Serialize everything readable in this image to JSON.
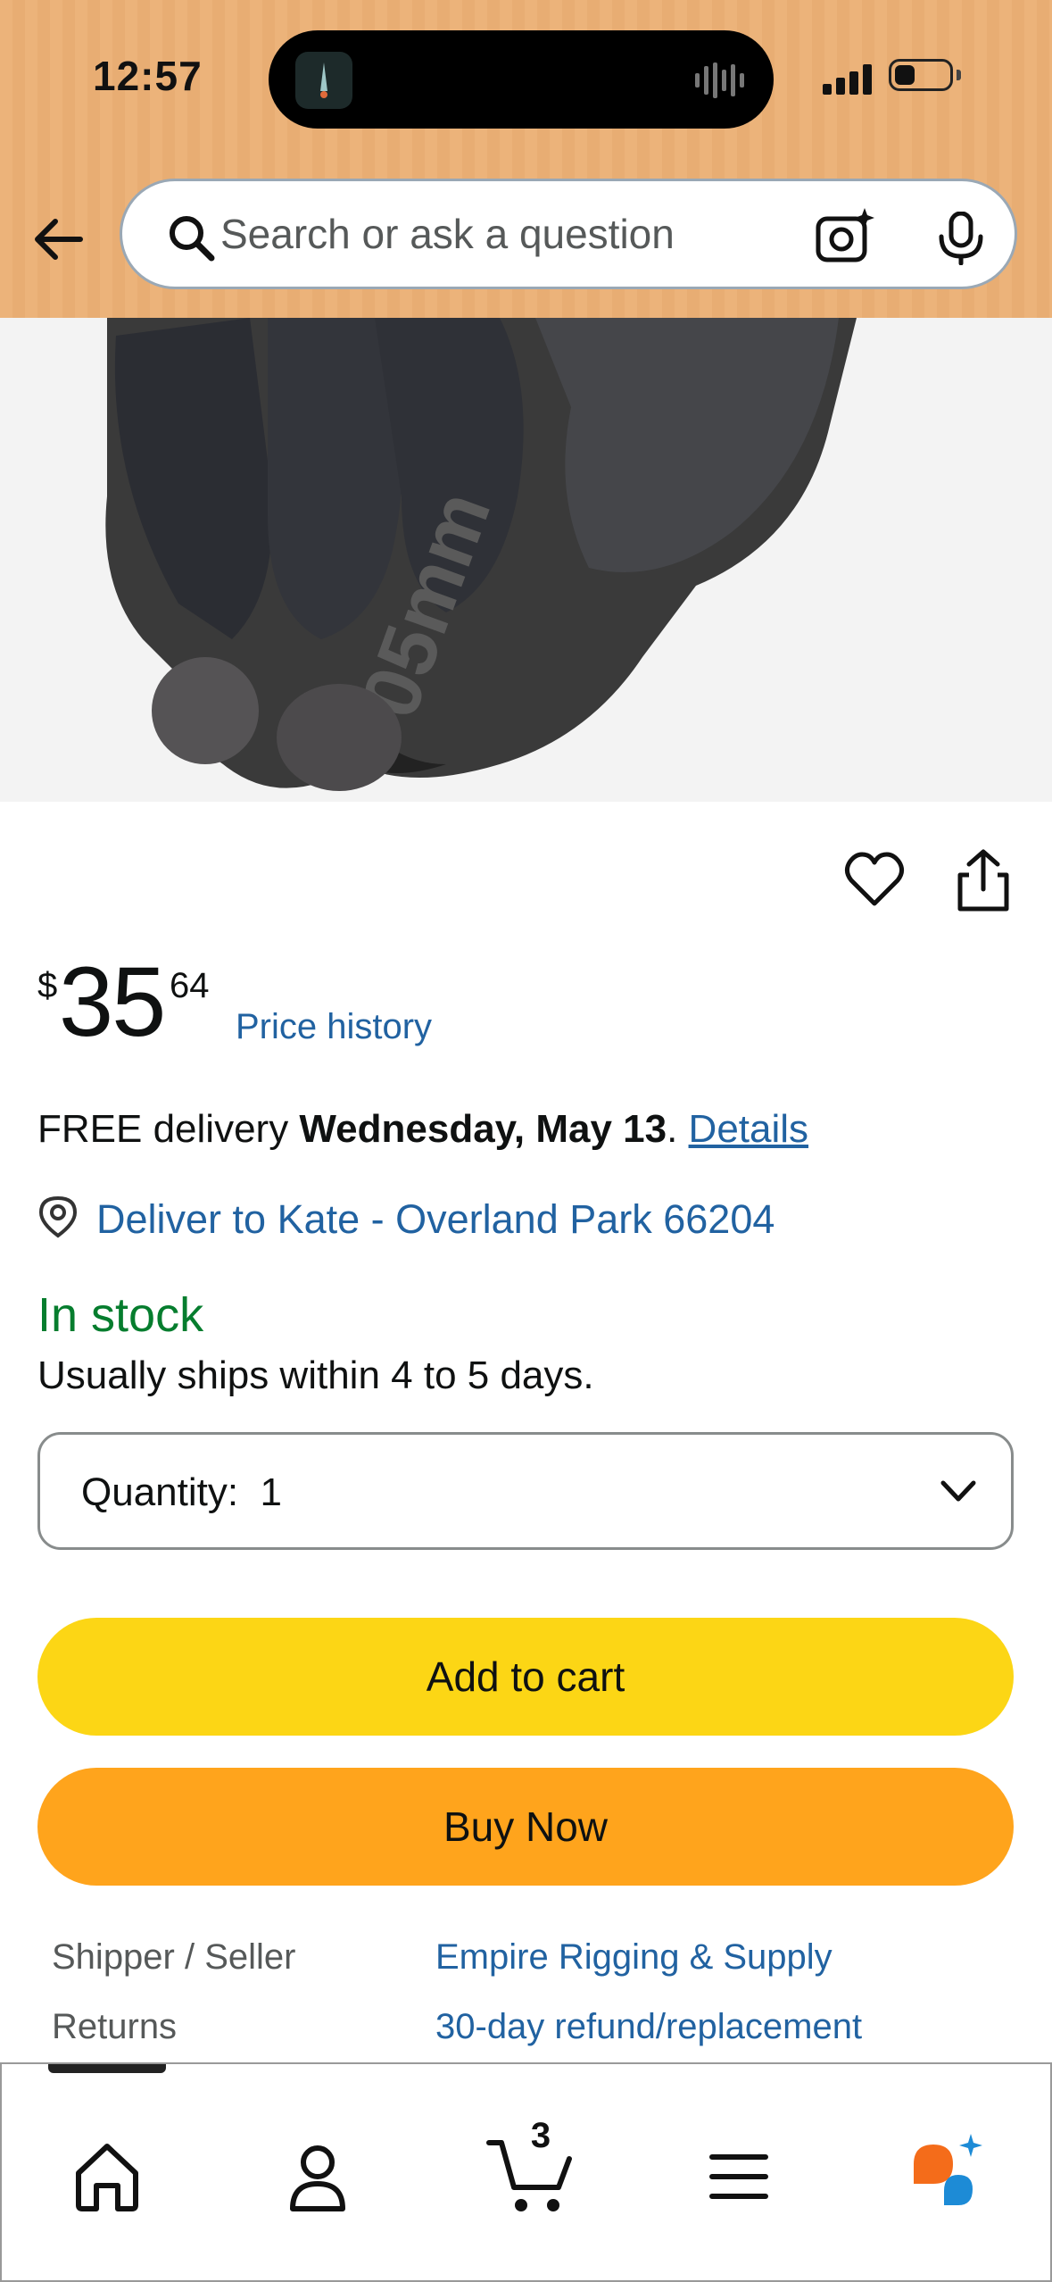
{
  "status_bar": {
    "time": "12:57"
  },
  "search": {
    "placeholder": "Search or ask a question"
  },
  "product": {
    "price": {
      "symbol": "$",
      "whole": "35",
      "fraction": "64"
    },
    "price_history_label": "Price history",
    "delivery": {
      "prefix": "FREE delivery ",
      "date": "Wednesday, May 13",
      "suffix": ". ",
      "details_link": "Details"
    },
    "deliver_to": "Deliver to Kate - Overland Park 66204",
    "stock_status": "In stock",
    "ships_note": "Usually ships within 4 to 5 days.",
    "quantity_label": "Quantity:",
    "quantity_value": "1",
    "add_to_cart_label": "Add to cart",
    "buy_now_label": "Buy Now",
    "info_rows": [
      {
        "label": "Shipper / Seller",
        "value": "Empire Rigging & Supply"
      },
      {
        "label": "Returns",
        "value": "30-day refund/replacement"
      }
    ]
  },
  "bottom_nav": {
    "items": [
      {
        "icon": "home-icon"
      },
      {
        "icon": "account-icon"
      },
      {
        "icon": "cart-icon",
        "badge": "3"
      },
      {
        "icon": "menu-icon"
      },
      {
        "icon": "rufus-assistant-icon"
      }
    ]
  },
  "colors": {
    "header": "#ecb37a",
    "link": "#2162a1",
    "in_stock": "#067d2e",
    "add_to_cart": "#fcd615",
    "buy_now": "#ffa41c"
  }
}
